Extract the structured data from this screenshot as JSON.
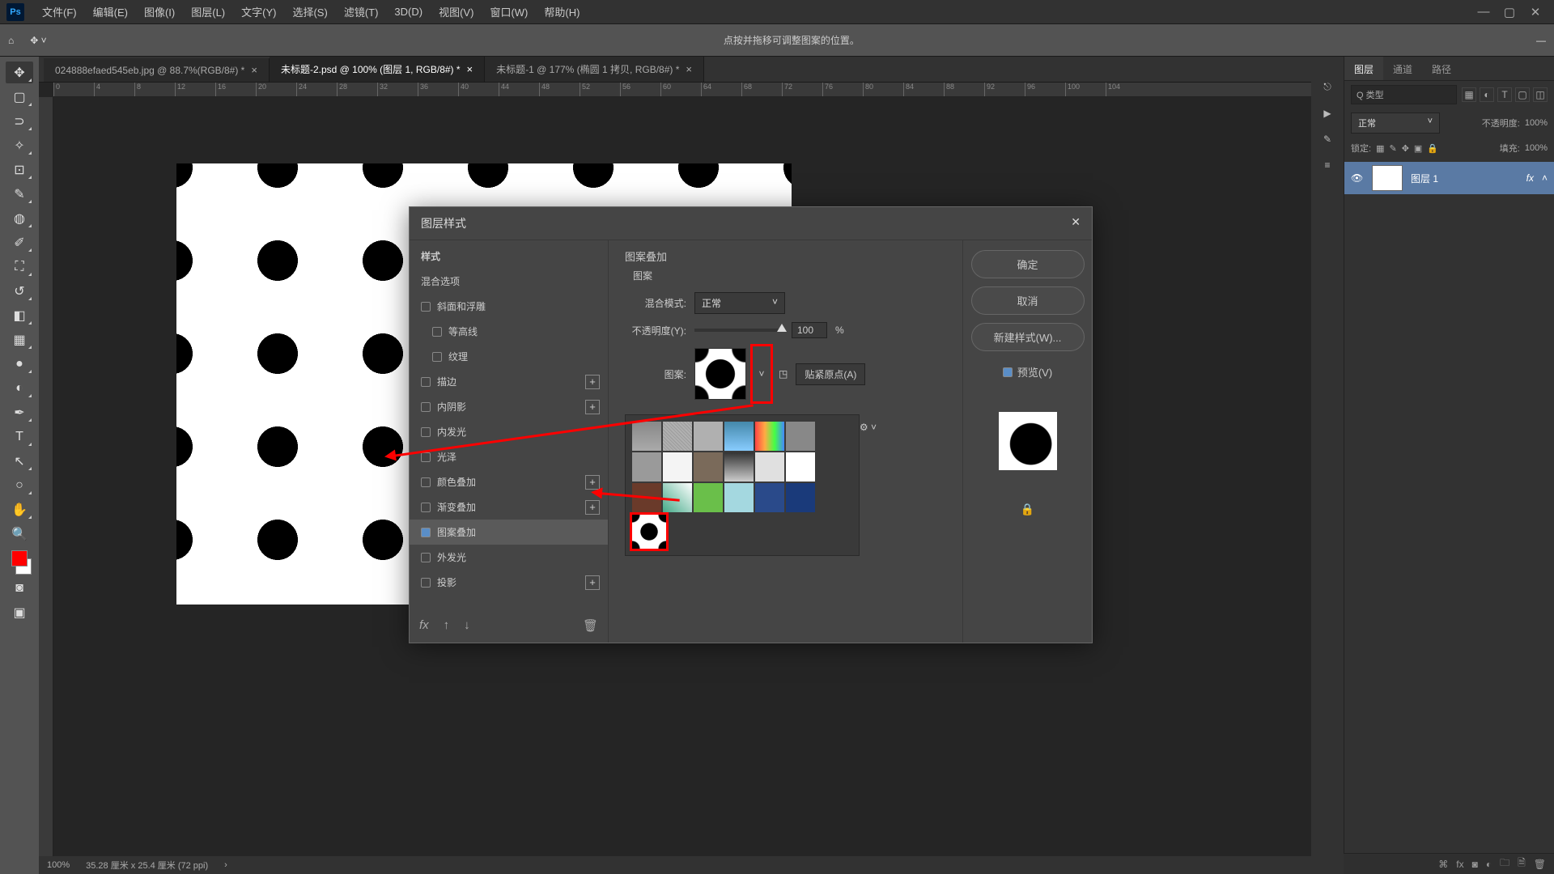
{
  "app": {
    "logo": "Ps"
  },
  "menu": {
    "file": "文件(F)",
    "edit": "编辑(E)",
    "image": "图像(I)",
    "layer": "图层(L)",
    "type": "文字(Y)",
    "select": "选择(S)",
    "filter": "滤镜(T)",
    "3d": "3D(D)",
    "view": "视图(V)",
    "window": "窗口(W)",
    "help": "帮助(H)"
  },
  "optionbar": {
    "hint": "点按并拖移可调整图案的位置。"
  },
  "tabs": {
    "t1": "024888efaed545eb.jpg @ 88.7%(RGB/8#) *",
    "t2": "未标题-2.psd @ 100% (图层 1, RGB/8#) *",
    "t3": "未标题-1 @ 177% (椭圆 1 拷贝, RGB/8#) *"
  },
  "ruler": {
    "marks": [
      "0",
      "4",
      "8",
      "12",
      "16",
      "20",
      "24",
      "28",
      "32",
      "36",
      "40",
      "44",
      "48",
      "52",
      "56",
      "60",
      "64",
      "68",
      "72",
      "76",
      "80",
      "84",
      "88",
      "92",
      "96",
      "100",
      "104"
    ]
  },
  "status": {
    "zoom": "100%",
    "docsize": "35.28 厘米 x 25.4 厘米 (72 ppi)"
  },
  "layers": {
    "tab_layers": "图层",
    "tab_channels": "通道",
    "tab_paths": "路径",
    "kind_label": "Q 类型",
    "blend": "正常",
    "opacity_label": "不透明度:",
    "opacity_val": "100%",
    "lock_label": "锁定:",
    "fill_label": "填充:",
    "fill_val": "100%",
    "layer1": "图层 1",
    "fx": "fx"
  },
  "modal": {
    "title": "图层样式",
    "styles_header": "样式",
    "blend_opts": "混合选项",
    "bevel": "斜面和浮雕",
    "contour": "等高线",
    "texture": "纹理",
    "stroke": "描边",
    "inner_shadow": "内阴影",
    "inner_glow": "内发光",
    "satin": "光泽",
    "color_overlay": "颜色叠加",
    "grad_overlay": "渐变叠加",
    "pattern_overlay": "图案叠加",
    "outer_glow": "外发光",
    "drop_shadow": "投影",
    "fx_footer": "fx",
    "pane_title": "图案叠加",
    "pane_sub": "图案",
    "blend_mode_label": "混合模式:",
    "blend_mode_val": "正常",
    "opacity_label": "不透明度(Y):",
    "opacity_val": "100",
    "opacity_pct": "%",
    "pattern_label": "图案:",
    "snap_origin": "贴紧原点(A)",
    "ok": "确定",
    "cancel": "取消",
    "new_style": "新建样式(W)...",
    "preview": "预览(V)"
  }
}
